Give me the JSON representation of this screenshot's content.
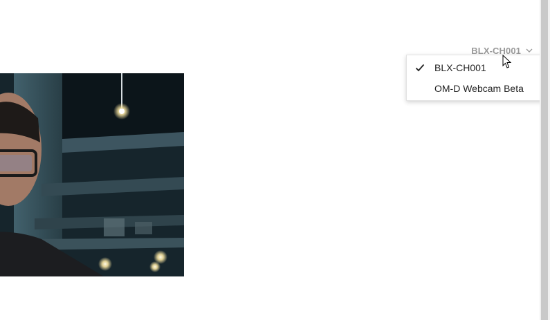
{
  "camera": {
    "selected_label": "BLX-CH001",
    "preview_icon": "webcam-video-feed"
  },
  "dropdown": {
    "items": [
      {
        "label": "BLX-CH001",
        "checked": true
      },
      {
        "label": "OM-D Webcam Beta",
        "checked": false
      }
    ]
  },
  "icons": {
    "check": "check-icon",
    "chevron": "chevron-down-icon",
    "cursor": "mouse-pointer-icon"
  },
  "colors": {
    "background": "#ffffff",
    "selector_text": "#9a9a9a",
    "menu_text": "#222222",
    "scrollbar_thumb": "#c9c9c9"
  }
}
